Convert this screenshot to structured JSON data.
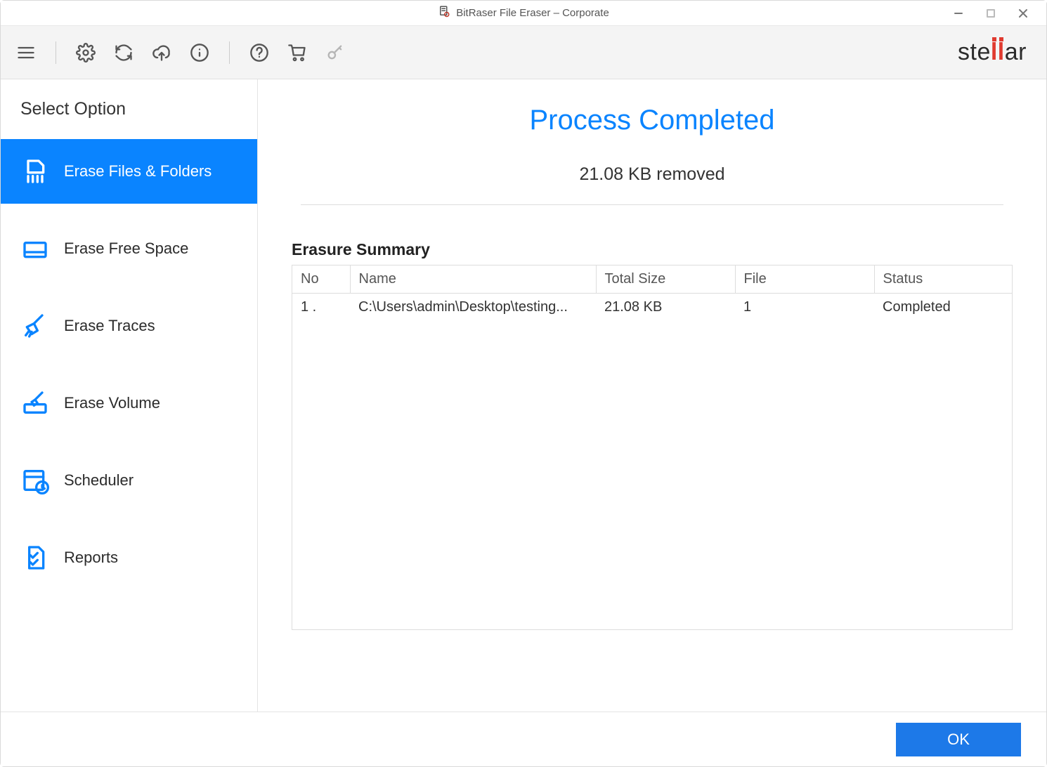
{
  "titlebar": {
    "title": "BitRaser File Eraser – Corporate"
  },
  "brand": {
    "prefix": "ste",
    "accent": "ll",
    "suffix": "ar"
  },
  "sidebar": {
    "header": "Select Option",
    "items": [
      {
        "label": "Erase Files & Folders"
      },
      {
        "label": "Erase Free Space"
      },
      {
        "label": "Erase Traces"
      },
      {
        "label": "Erase Volume"
      },
      {
        "label": "Scheduler"
      },
      {
        "label": "Reports"
      }
    ]
  },
  "main": {
    "title": "Process Completed",
    "subtitle": "21.08 KB removed",
    "summary_label": "Erasure Summary",
    "columns": {
      "no": "No",
      "name": "Name",
      "size": "Total Size",
      "file": "File",
      "status": "Status"
    },
    "rows": [
      {
        "no": "1 .",
        "name": "C:\\Users\\admin\\Desktop\\testing...",
        "size": "21.08 KB",
        "file": "1",
        "status": "Completed"
      }
    ]
  },
  "footer": {
    "ok_label": "OK"
  }
}
